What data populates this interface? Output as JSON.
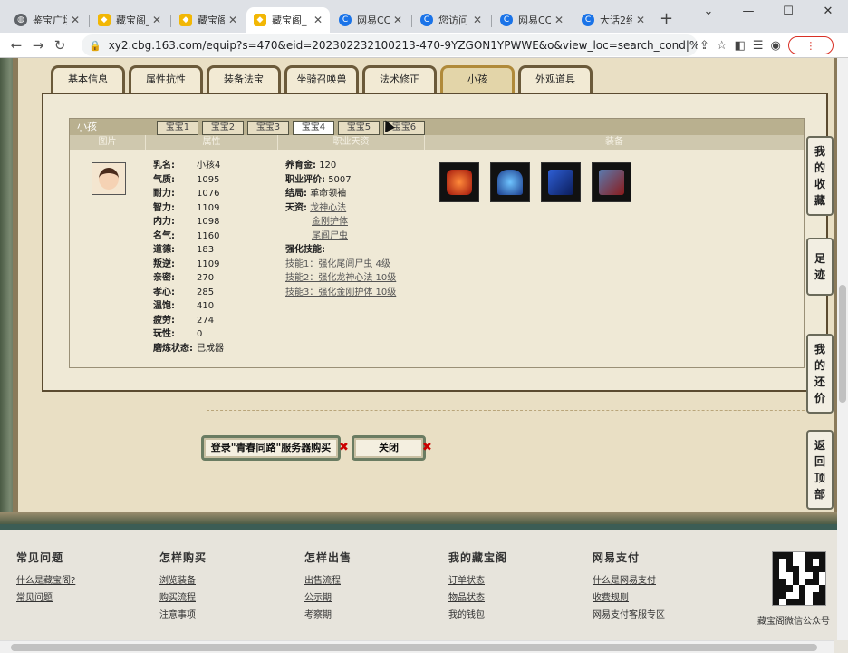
{
  "browser": {
    "tabs": [
      {
        "title": "鉴宝广场",
        "icon": "globe"
      },
      {
        "title": "藏宝阁_",
        "icon": "cbg"
      },
      {
        "title": "藏宝阁_",
        "icon": "cbg"
      },
      {
        "title": "藏宝阁_",
        "icon": "cbg",
        "active": true
      },
      {
        "title": "网易CC",
        "icon": "cc"
      },
      {
        "title": "您访问",
        "icon": "cc"
      },
      {
        "title": "网易CC",
        "icon": "cc"
      },
      {
        "title": "大话2经",
        "icon": "cc"
      }
    ],
    "new_tab": "+",
    "url": "xy2.cbg.163.com/equip?s=470&eid=202302232100213-470-9YZGON1YPWWE&o&view_loc=search_cond|%7B\"is_fro...",
    "menu_label": "⋮"
  },
  "main_tabs": [
    "基本信息",
    "属性抗性",
    "装备法宝",
    "坐骑召唤兽",
    "法术修正",
    "小孩",
    "外观道具"
  ],
  "child_panel": {
    "title": "小孩",
    "baby_tabs": [
      "宝宝1",
      "宝宝2",
      "宝宝3",
      "宝宝4",
      "宝宝5",
      "宝宝6"
    ],
    "active_baby": "宝宝4",
    "columns": [
      "图片",
      "属性",
      "职业天资",
      "装备"
    ],
    "attributes": [
      {
        "label": "乳名:",
        "value": "小孩4"
      },
      {
        "label": "气质:",
        "value": "1095"
      },
      {
        "label": "耐力:",
        "value": "1076"
      },
      {
        "label": "智力:",
        "value": "1109"
      },
      {
        "label": "内力:",
        "value": "1098"
      },
      {
        "label": "名气:",
        "value": "1160"
      },
      {
        "label": "道德:",
        "value": "183"
      },
      {
        "label": "叛逆:",
        "value": "1109"
      },
      {
        "label": "亲密:",
        "value": "270"
      },
      {
        "label": "孝心:",
        "value": "285"
      },
      {
        "label": "温饱:",
        "value": "410"
      },
      {
        "label": "疲劳:",
        "value": "274"
      },
      {
        "label": "玩性:",
        "value": "0"
      },
      {
        "label": "磨炼状态:",
        "value": "已成器"
      }
    ],
    "career": {
      "upbringing_label": "养育金:",
      "upbringing": "120",
      "rating_label": "职业评价:",
      "rating": "5007",
      "ending_label": "结局:",
      "ending": "革命领袖",
      "talent_label": "天资:",
      "talents": [
        "龙神心法",
        "金刚护体",
        "尾闾尸虫"
      ],
      "skills_label": "强化技能:",
      "skills": [
        "技能1：强化尾闾尸虫 4级",
        "技能2：强化龙神心法 10级",
        "技能3：强化金刚护体 10级"
      ]
    },
    "equipment": [
      "red-item",
      "blue-robe",
      "blue-book",
      "dark-chest"
    ]
  },
  "buttons": {
    "login": "登录\"青春同路\"服务器购买",
    "close": "关闭",
    "x": "✖"
  },
  "side_buttons": [
    "我的收藏",
    "足迹",
    "我的还价",
    "返回顶部"
  ],
  "footer": {
    "cols": [
      {
        "title": "常见问题",
        "links": [
          "什么是藏宝阁?",
          "常见问题"
        ]
      },
      {
        "title": "怎样购买",
        "links": [
          "浏览装备",
          "购买流程",
          "注意事项"
        ]
      },
      {
        "title": "怎样出售",
        "links": [
          "出售流程",
          "公示期",
          "考察期"
        ]
      },
      {
        "title": "我的藏宝阁",
        "links": [
          "订单状态",
          "物品状态",
          "我的钱包"
        ]
      },
      {
        "title": "网易支付",
        "links": [
          "什么是网易支付",
          "收费规则",
          "网易支付客服专区"
        ]
      }
    ],
    "qr_caption": "藏宝阁微信公众号"
  }
}
